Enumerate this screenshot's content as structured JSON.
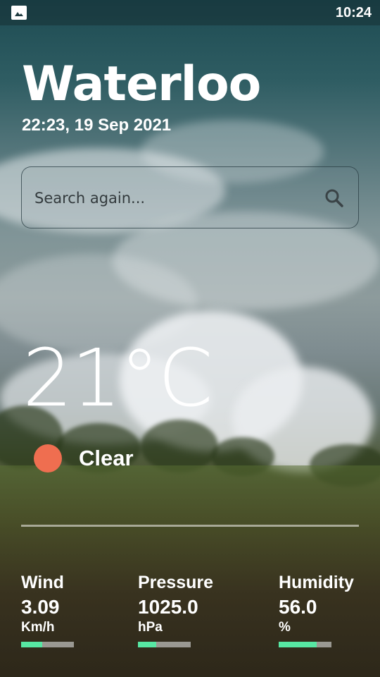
{
  "status_bar": {
    "time": "10:24",
    "icon": "image-icon"
  },
  "location": {
    "city": "Waterloo",
    "datetime": "22:23, 19 Sep 2021"
  },
  "search": {
    "placeholder": "Search again...",
    "icon": "search-icon"
  },
  "current": {
    "temperature": "21°C",
    "condition": "Clear",
    "condition_color": "#ef6e50"
  },
  "stats": [
    {
      "label": "Wind",
      "value": "3.09",
      "unit": "Km/h",
      "level": 0.4
    },
    {
      "label": "Pressure",
      "value": "1025.0",
      "unit": "hPa",
      "level": 0.35
    },
    {
      "label": "Humidity",
      "value": "56.0",
      "unit": "%",
      "level": 0.72
    }
  ],
  "colors": {
    "bar_fill": "#57e7a3",
    "bar_track": "#bebeb9"
  }
}
